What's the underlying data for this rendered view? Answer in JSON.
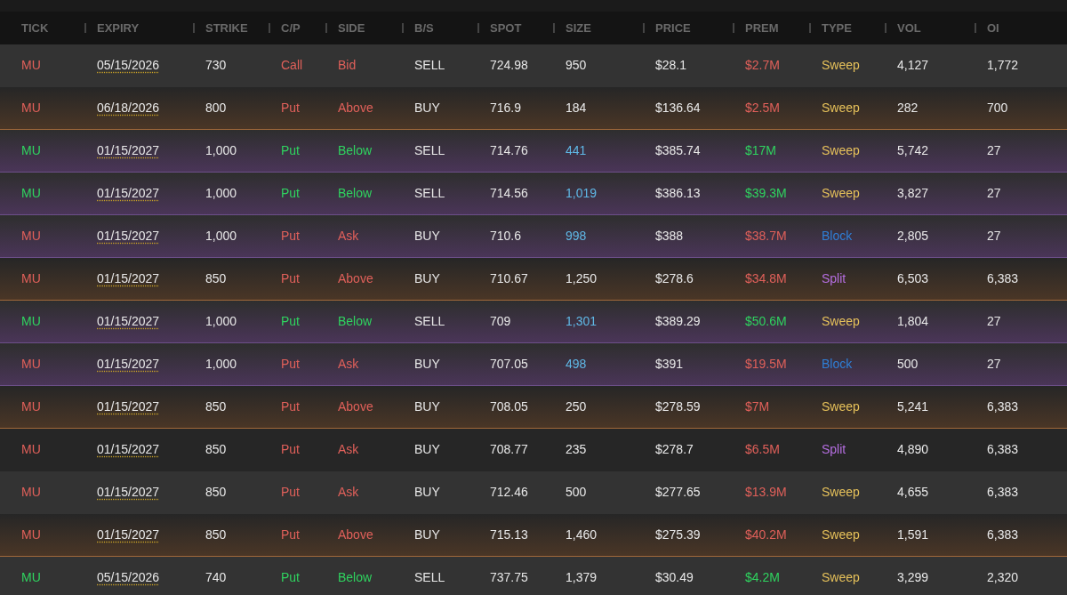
{
  "table": {
    "columns": [
      "TICK",
      "EXPIRY",
      "STRIKE",
      "C/P",
      "SIDE",
      "B/S",
      "SPOT",
      "SIZE",
      "PRICE",
      "PREM",
      "TYPE",
      "VOL",
      "OI"
    ],
    "rows": [
      {
        "tick": "MU",
        "expiry": "05/15/2026",
        "strike": "730",
        "cp": "Call",
        "side": "Bid",
        "bs": "SELL",
        "spot": "724.98",
        "size": "950",
        "size_highlight": false,
        "price": "$28.1",
        "prem": "$2.7M",
        "type": {
          "label": "Sweep",
          "color": "#e6c15a"
        },
        "vol": "4,127",
        "oi": "1,772",
        "bullish": false,
        "orange_band": false,
        "purple_band": false
      },
      {
        "tick": "MU",
        "expiry": "06/18/2026",
        "strike": "800",
        "cp": "Put",
        "side": "Above",
        "bs": "BUY",
        "spot": "716.9",
        "size": "184",
        "size_highlight": false,
        "price": "$136.64",
        "prem": "$2.5M",
        "type": {
          "label": "Sweep",
          "color": "#e6c15a"
        },
        "vol": "282",
        "oi": "700",
        "bullish": false,
        "orange_band": true,
        "purple_band": false
      },
      {
        "tick": "MU",
        "expiry": "01/15/2027",
        "strike": "1,000",
        "cp": "Put",
        "side": "Below",
        "bs": "SELL",
        "spot": "714.76",
        "size": "441",
        "size_highlight": true,
        "price": "$385.74",
        "prem": "$17M",
        "type": {
          "label": "Sweep",
          "color": "#e6c15a"
        },
        "vol": "5,742",
        "oi": "27",
        "bullish": true,
        "orange_band": false,
        "purple_band": true
      },
      {
        "tick": "MU",
        "expiry": "01/15/2027",
        "strike": "1,000",
        "cp": "Put",
        "side": "Below",
        "bs": "SELL",
        "spot": "714.56",
        "size": "1,019",
        "size_highlight": true,
        "price": "$386.13",
        "prem": "$39.3M",
        "type": {
          "label": "Sweep",
          "color": "#e6c15a"
        },
        "vol": "3,827",
        "oi": "27",
        "bullish": true,
        "orange_band": false,
        "purple_band": true
      },
      {
        "tick": "MU",
        "expiry": "01/15/2027",
        "strike": "1,000",
        "cp": "Put",
        "side": "Ask",
        "bs": "BUY",
        "spot": "710.6",
        "size": "998",
        "size_highlight": true,
        "price": "$388",
        "prem": "$38.7M",
        "type": {
          "label": "Block",
          "color": "#2f7fd6"
        },
        "vol": "2,805",
        "oi": "27",
        "bullish": false,
        "orange_band": false,
        "purple_band": true
      },
      {
        "tick": "MU",
        "expiry": "01/15/2027",
        "strike": "850",
        "cp": "Put",
        "side": "Above",
        "bs": "BUY",
        "spot": "710.67",
        "size": "1,250",
        "size_highlight": false,
        "price": "$278.6",
        "prem": "$34.8M",
        "type": {
          "label": "Split",
          "color": "#b56ee0"
        },
        "vol": "6,503",
        "oi": "6,383",
        "bullish": false,
        "orange_band": true,
        "purple_band": false
      },
      {
        "tick": "MU",
        "expiry": "01/15/2027",
        "strike": "1,000",
        "cp": "Put",
        "side": "Below",
        "bs": "SELL",
        "spot": "709",
        "size": "1,301",
        "size_highlight": true,
        "price": "$389.29",
        "prem": "$50.6M",
        "type": {
          "label": "Sweep",
          "color": "#e6c15a"
        },
        "vol": "1,804",
        "oi": "27",
        "bullish": true,
        "orange_band": false,
        "purple_band": true
      },
      {
        "tick": "MU",
        "expiry": "01/15/2027",
        "strike": "1,000",
        "cp": "Put",
        "side": "Ask",
        "bs": "BUY",
        "spot": "707.05",
        "size": "498",
        "size_highlight": true,
        "price": "$391",
        "prem": "$19.5M",
        "type": {
          "label": "Block",
          "color": "#2f7fd6"
        },
        "vol": "500",
        "oi": "27",
        "bullish": false,
        "orange_band": false,
        "purple_band": true
      },
      {
        "tick": "MU",
        "expiry": "01/15/2027",
        "strike": "850",
        "cp": "Put",
        "side": "Above",
        "bs": "BUY",
        "spot": "708.05",
        "size": "250",
        "size_highlight": false,
        "price": "$278.59",
        "prem": "$7M",
        "type": {
          "label": "Sweep",
          "color": "#e6c15a"
        },
        "vol": "5,241",
        "oi": "6,383",
        "bullish": false,
        "orange_band": true,
        "purple_band": false
      },
      {
        "tick": "MU",
        "expiry": "01/15/2027",
        "strike": "850",
        "cp": "Put",
        "side": "Ask",
        "bs": "BUY",
        "spot": "708.77",
        "size": "235",
        "size_highlight": false,
        "price": "$278.7",
        "prem": "$6.5M",
        "type": {
          "label": "Split",
          "color": "#b56ee0"
        },
        "vol": "4,890",
        "oi": "6,383",
        "bullish": false,
        "orange_band": false,
        "purple_band": false
      },
      {
        "tick": "MU",
        "expiry": "01/15/2027",
        "strike": "850",
        "cp": "Put",
        "side": "Ask",
        "bs": "BUY",
        "spot": "712.46",
        "size": "500",
        "size_highlight": false,
        "price": "$277.65",
        "prem": "$13.9M",
        "type": {
          "label": "Sweep",
          "color": "#e6c15a"
        },
        "vol": "4,655",
        "oi": "6,383",
        "bullish": false,
        "orange_band": false,
        "purple_band": false
      },
      {
        "tick": "MU",
        "expiry": "01/15/2027",
        "strike": "850",
        "cp": "Put",
        "side": "Above",
        "bs": "BUY",
        "spot": "715.13",
        "size": "1,460",
        "size_highlight": false,
        "price": "$275.39",
        "prem": "$40.2M",
        "type": {
          "label": "Sweep",
          "color": "#e6c15a"
        },
        "vol": "1,591",
        "oi": "6,383",
        "bullish": false,
        "orange_band": true,
        "purple_band": false
      },
      {
        "tick": "MU",
        "expiry": "05/15/2026",
        "strike": "740",
        "cp": "Put",
        "side": "Below",
        "bs": "SELL",
        "spot": "737.75",
        "size": "1,379",
        "size_highlight": false,
        "price": "$30.49",
        "prem": "$4.2M",
        "type": {
          "label": "Sweep",
          "color": "#e6c15a"
        },
        "vol": "3,299",
        "oi": "2,320",
        "bullish": true,
        "orange_band": false,
        "purple_band": false
      }
    ]
  }
}
